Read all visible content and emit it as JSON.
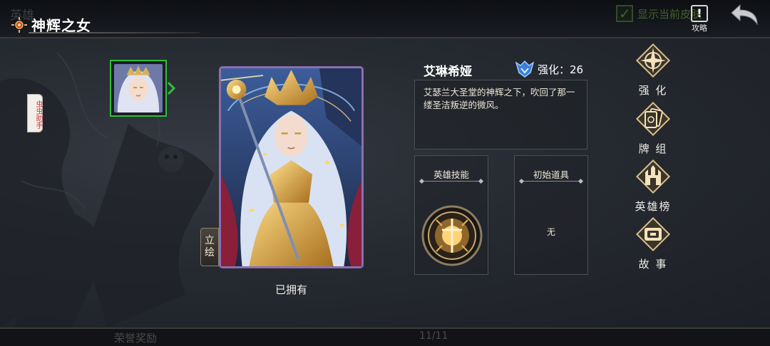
{
  "header": {
    "back_title": "英雄",
    "title": "神辉之女",
    "show_current_label": "显示当前皮肤",
    "show_current_checked": true,
    "guide_label": "攻略",
    "guide_icon": "exclamation-book-icon",
    "back_icon": "return-arrow-icon"
  },
  "helper_tab": "虫虫助手",
  "portrait_tab": "立绘",
  "owned_status": "已拥有",
  "hero": {
    "name": "艾琳希娅",
    "enhance_label": "强化：26",
    "description": "艾瑟兰大圣堂的神辉之下，吹回了那一缕圣洁叛逆的微风。"
  },
  "slots": {
    "skill_title": "英雄技能",
    "item_title": "初始道具",
    "item_value": "无"
  },
  "side_menu": [
    {
      "label": "强 化",
      "icon": "compass-star-icon"
    },
    {
      "label": "牌 组",
      "icon": "card-deck-icon"
    },
    {
      "label": "英雄榜",
      "icon": "castle-gate-icon"
    },
    {
      "label": "故 事",
      "icon": "scroll-book-icon"
    }
  ],
  "bottom": {
    "honor_label": "荣誉奖励",
    "page_indicator": "11/11"
  },
  "colors": {
    "selected_border": "#2fbf3a",
    "card_border": "#8b6fb0",
    "gold": "#d8b25a",
    "background": "#262a31"
  }
}
